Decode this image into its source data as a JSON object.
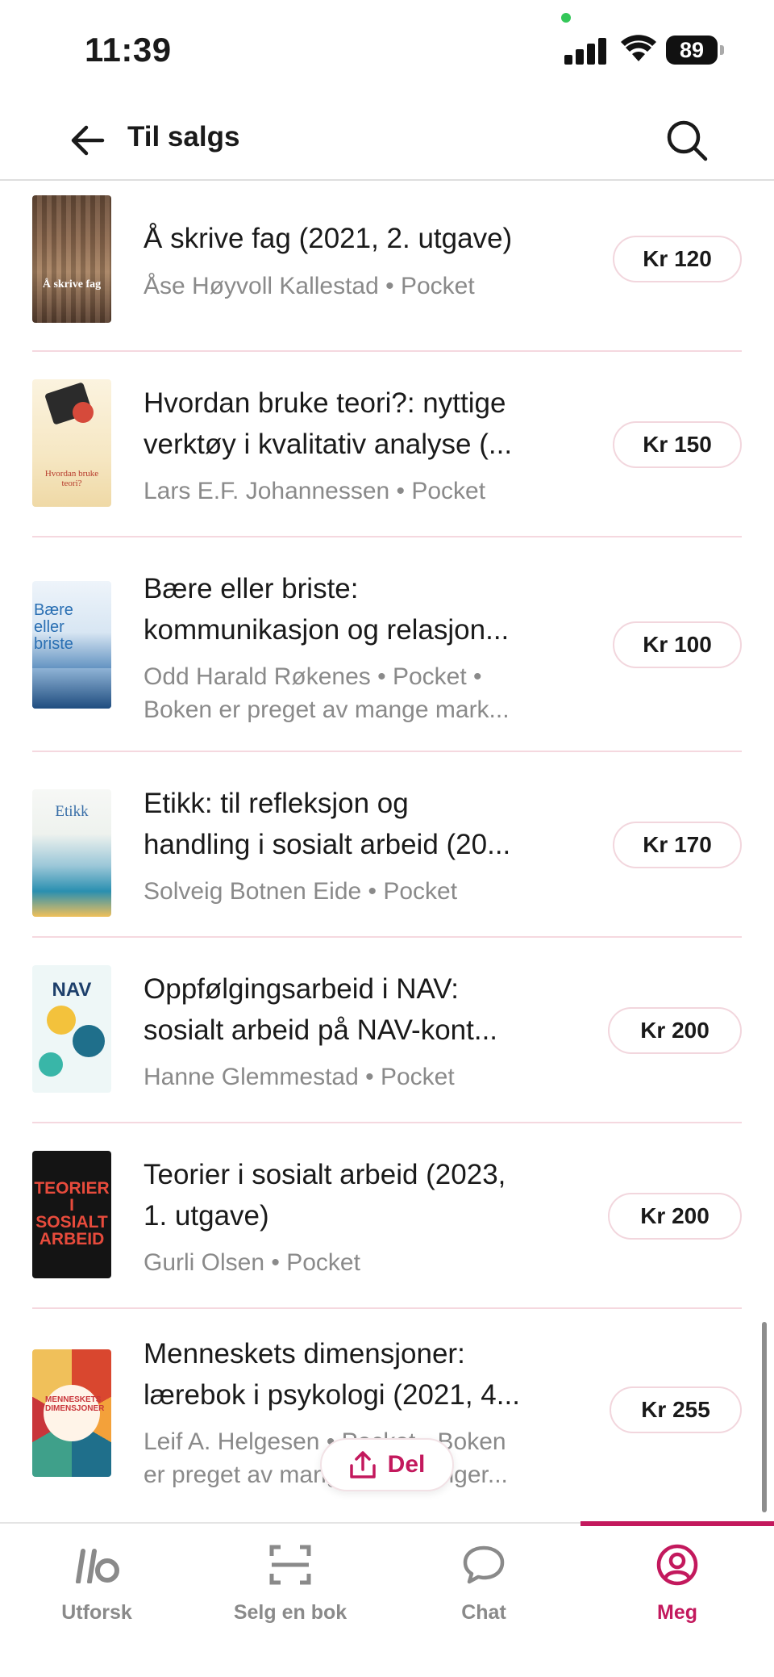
{
  "status_bar": {
    "time": "11:39",
    "battery": "89"
  },
  "header": {
    "title": "Til salgs"
  },
  "books": [
    {
      "title_lines": [
        "Å skrive fag (2021, 2. utgave)"
      ],
      "meta_lines": [
        "Åse Høyvoll Kallestad • Pocket"
      ],
      "price": "Kr 120",
      "cover_text": "Å skrive fag"
    },
    {
      "title_lines": [
        "Hvordan bruke teori?: nyttige",
        "verktøy i kvalitativ analyse (..."
      ],
      "meta_lines": [
        "Lars E.F. Johannessen • Pocket"
      ],
      "price": "Kr 150",
      "cover_text": "Hvordan bruke teori?"
    },
    {
      "title_lines": [
        "Bære eller briste:",
        "kommunikasjon og relasjon..."
      ],
      "meta_lines": [
        "Odd Harald Røkenes • Pocket •",
        "Boken er preget av mange mark..."
      ],
      "price": "Kr 100",
      "cover_text": "Bære eller briste"
    },
    {
      "title_lines": [
        "Etikk: til refleksjon og",
        "handling i sosialt arbeid (20..."
      ],
      "meta_lines": [
        "Solveig Botnen Eide • Pocket"
      ],
      "price": "Kr 170",
      "cover_text": "Etikk"
    },
    {
      "title_lines": [
        "Oppfølgingsarbeid i NAV:",
        "sosialt arbeid på NAV-kont..."
      ],
      "meta_lines": [
        "Hanne Glemmestad • Pocket"
      ],
      "price": "Kr 200",
      "cover_text": "NAV"
    },
    {
      "title_lines": [
        "Teorier i sosialt arbeid (2023,",
        "1. utgave)"
      ],
      "meta_lines": [
        "Gurli Olsen • Pocket"
      ],
      "price": "Kr 200",
      "cover_text": "TEORIER I SOSIALT ARBEID"
    },
    {
      "title_lines": [
        "Menneskets dimensjoner:",
        "lærebok i psykologi (2021, 4..."
      ],
      "meta_lines": [
        "Leif A. Helgesen • Pocket • Boken",
        "er preget av mange markeringer..."
      ],
      "price": "Kr 255",
      "cover_text": "MENNESKETS DIMENSJONER"
    }
  ],
  "share": {
    "label": "Del"
  },
  "nav": {
    "items": [
      {
        "label": "Utforsk",
        "icon": "ib-logo-icon"
      },
      {
        "label": "Selg en bok",
        "icon": "scan-icon"
      },
      {
        "label": "Chat",
        "icon": "chat-bubble-icon"
      },
      {
        "label": "Meg",
        "icon": "profile-icon"
      }
    ],
    "active": "Meg"
  },
  "colors": {
    "accent": "#c3195d",
    "divider": "#f5d8df",
    "muted_text": "#8a8a8a"
  }
}
